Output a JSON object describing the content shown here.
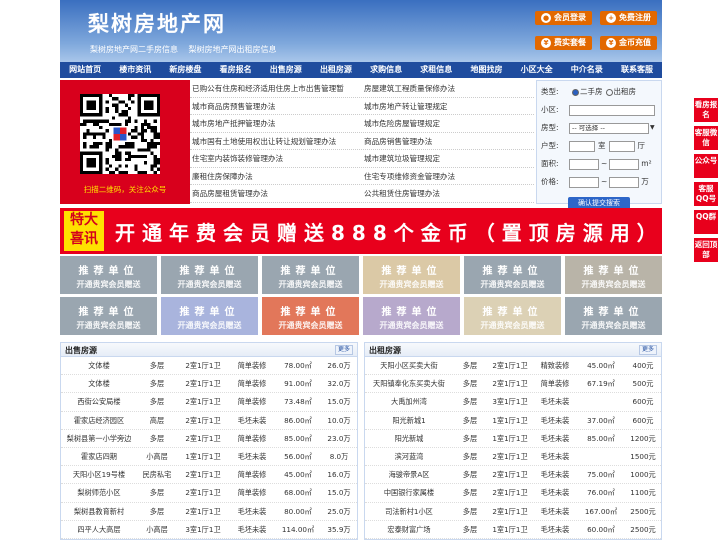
{
  "header": {
    "site_name": "梨树房地产网",
    "sub_links": [
      "梨树房地产网二手房信息",
      "梨树房地产网出租房信息"
    ],
    "buttons": [
      "会员登录",
      "免费注册",
      "费实套餐",
      "金币充值"
    ]
  },
  "nav": [
    "网站首页",
    "楼市资讯",
    "新房楼盘",
    "看房报名",
    "出售房源",
    "出租房源",
    "求购信息",
    "求租信息",
    "地图找房",
    "小区大全",
    "中介名录",
    "联系客服"
  ],
  "qr_caption": "扫描二维码，关注公众号",
  "links": [
    [
      "已购公有住房和经济适用住房上市出售管理暂",
      "房屋建筑工程质量保修办法"
    ],
    [
      "城市商品房预售管理办法",
      "城市房地产转让管理规定"
    ],
    [
      "城市房地产抵押管理办法",
      "城市危险房屋管理规定"
    ],
    [
      "城市国有土地使用权出让转让规划管理办法",
      "商品房销售管理办法"
    ],
    [
      "住宅室内装饰装修管理办法",
      "城市建筑垃圾管理规定"
    ],
    [
      "廉租住房保障办法",
      "住宅专项维修资金管理办法"
    ],
    [
      "商品房屋租赁管理办法",
      "公共租赁住房管理办法"
    ]
  ],
  "search": {
    "type_label": "类型:",
    "type_options": [
      "二手房",
      "出租房"
    ],
    "community_label": "小区:",
    "room_type_label": "房型:",
    "room_type_value": "-- 可选择 --",
    "layout_label": "户型:",
    "room_unit": "室",
    "hall_unit": "厅",
    "area_label": "面积:",
    "price_label": "价格:",
    "range_sep": "~",
    "area_unit": "m²",
    "price_unit": "万",
    "submit": "确认提交搜索"
  },
  "banner": {
    "tag_line1": "特大",
    "tag_line2": "喜讯",
    "text": "开通年费会员赠送888个金币（置顶房源用）"
  },
  "tiles": {
    "title": "推荐单位",
    "subtitle": "开通贵宾会员赠送",
    "colors": [
      "#9aa6b0",
      "#9aa6b0",
      "#9aa6b0",
      "#dbc9a6",
      "#9aa6b0",
      "#b9b4a8",
      "#9aa6b0",
      "#a9b4dd",
      "#e2775a",
      "#b7a9cc",
      "#dcd1b5",
      "#9aa6b0"
    ]
  },
  "sale": {
    "title": "出售房源",
    "more": "更多",
    "rows": [
      [
        "文体楼",
        "多层",
        "2室1厅1卫",
        "简单装修",
        "78.00㎡",
        "26.0万"
      ],
      [
        "文体楼",
        "多层",
        "2室1厅1卫",
        "简单装修",
        "91.00㎡",
        "32.0万"
      ],
      [
        "西街公安局楼",
        "多层",
        "2室1厅1卫",
        "简单装修",
        "73.48㎡",
        "15.0万"
      ],
      [
        "霍家店经济园区",
        "高层",
        "2室1厅1卫",
        "毛坯未装",
        "86.00㎡",
        "10.0万"
      ],
      [
        "梨树县第一小学旁边",
        "多层",
        "2室1厅1卫",
        "简单装修",
        "85.00㎡",
        "23.0万"
      ],
      [
        "霍家店四期",
        "小高层",
        "1室1厅1卫",
        "毛坯未装",
        "56.00㎡",
        "8.0万"
      ],
      [
        "天阳小区19号楼",
        "民房私宅",
        "2室1厅1卫",
        "简单装修",
        "45.00㎡",
        "16.0万"
      ],
      [
        "梨树师范小区",
        "多层",
        "2室1厅1卫",
        "简单装修",
        "68.00㎡",
        "15.0万"
      ],
      [
        "梨树县教育新村",
        "多层",
        "2室1厅1卫",
        "毛坯未装",
        "80.00㎡",
        "25.0万"
      ],
      [
        "四平人大高层",
        "小高层",
        "3室1厅1卫",
        "毛坯未装",
        "114.00㎡",
        "35.9万"
      ]
    ]
  },
  "rent": {
    "title": "出租房源",
    "more": "更多",
    "rows": [
      [
        "天阳小区买卖大街",
        "多层",
        "2室1厅1卫",
        "精致装修",
        "45.00㎡",
        "400元"
      ],
      [
        "天阳镇奉化东买卖大街",
        "多层",
        "2室1厅1卫",
        "简单装修",
        "67.19㎡",
        "500元"
      ],
      [
        "大禹加州湾",
        "多层",
        "3室1厅1卫",
        "毛坯未装",
        "",
        "600元"
      ],
      [
        "阳光新城1",
        "多层",
        "1室1厅1卫",
        "毛坯未装",
        "37.00㎡",
        "600元"
      ],
      [
        "阳光新城",
        "多层",
        "1室1厅1卫",
        "毛坯未装",
        "85.00㎡",
        "1200元"
      ],
      [
        "滨河蓝湾",
        "多层",
        "2室1厅1卫",
        "毛坯未装",
        "",
        "1500元"
      ],
      [
        "海骏帝景A区",
        "多层",
        "2室1厅1卫",
        "毛坯未装",
        "75.00㎡",
        "1000元"
      ],
      [
        "中国银行家属楼",
        "多层",
        "2室1厅1卫",
        "毛坯未装",
        "76.00㎡",
        "1100元"
      ],
      [
        "司法新村1小区",
        "多层",
        "2室1厅1卫",
        "毛坯未装",
        "167.00㎡",
        "2500元"
      ],
      [
        "宏泰财富广场",
        "多层",
        "1室1厅1卫",
        "毛坯未装",
        "60.00㎡",
        "2500元"
      ]
    ]
  },
  "sidebar": [
    "看房报名",
    "客服微信",
    "公众号",
    "客服QQ号",
    "QQ群",
    "返回顶部"
  ]
}
